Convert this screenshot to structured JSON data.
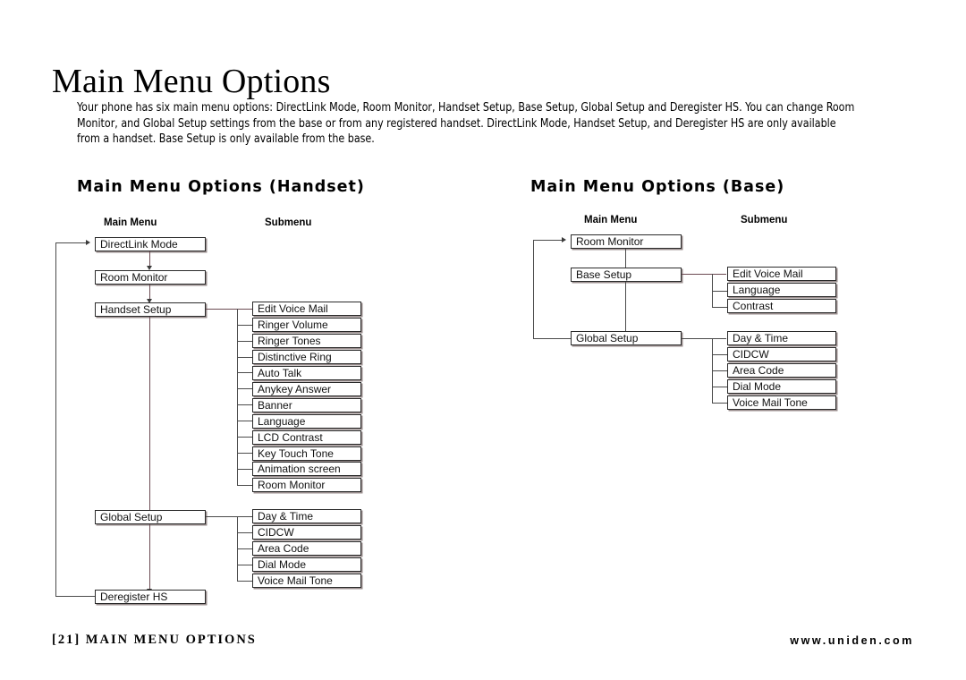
{
  "page": {
    "title": "Main Menu Options",
    "intro": "Your phone has six main menu options: DirectLink Mode, Room Monitor, Handset Setup, Base Setup, Global Setup and Deregister HS. You can change Room Monitor, and Global Setup settings from the base or from any registered handset. DirectLink Mode, Handset Setup, and Deregister HS are only available from a handset. Base Setup is only available from the base."
  },
  "colors": {
    "box_border": "#2b2b2b",
    "box_shadow": "#9a8e8e",
    "connector": "#4b4b4b",
    "connector_accent": "#6b4a52",
    "text": "#000000",
    "background": "#ffffff"
  },
  "handset": {
    "heading": "Main Menu Options (Handset)",
    "col_main_label": "Main Menu",
    "col_sub_label": "Submenu",
    "main_items": [
      {
        "label": "DirectLink Mode"
      },
      {
        "label": "Room Monitor"
      },
      {
        "label": "Handset Setup"
      },
      {
        "label": "Global Setup"
      },
      {
        "label": "Deregister HS"
      }
    ],
    "handset_setup_submenu": [
      "Edit Voice Mail",
      "Ringer Volume",
      "Ringer Tones",
      "Distinctive Ring",
      "Auto Talk",
      "Anykey Answer",
      "Banner",
      "Language",
      "LCD Contrast",
      "Key Touch Tone",
      "Animation screen",
      "Room Monitor"
    ],
    "global_setup_submenu": [
      "Day & Time",
      "CIDCW",
      "Area Code",
      "Dial Mode",
      "Voice Mail Tone"
    ]
  },
  "base": {
    "heading": "Main Menu Options (Base)",
    "col_main_label": "Main Menu",
    "col_sub_label": "Submenu",
    "main_items": [
      {
        "label": "Room Monitor"
      },
      {
        "label": "Base Setup"
      },
      {
        "label": "Global Setup"
      }
    ],
    "base_setup_submenu": [
      "Edit Voice Mail",
      "Language",
      "Contrast"
    ],
    "global_setup_submenu": [
      "Day & Time",
      "CIDCW",
      "Area Code",
      "Dial Mode",
      "Voice Mail Tone"
    ]
  },
  "footer": {
    "left": "[21] MAIN MENU OPTIONS",
    "right": "www.uniden.com"
  }
}
